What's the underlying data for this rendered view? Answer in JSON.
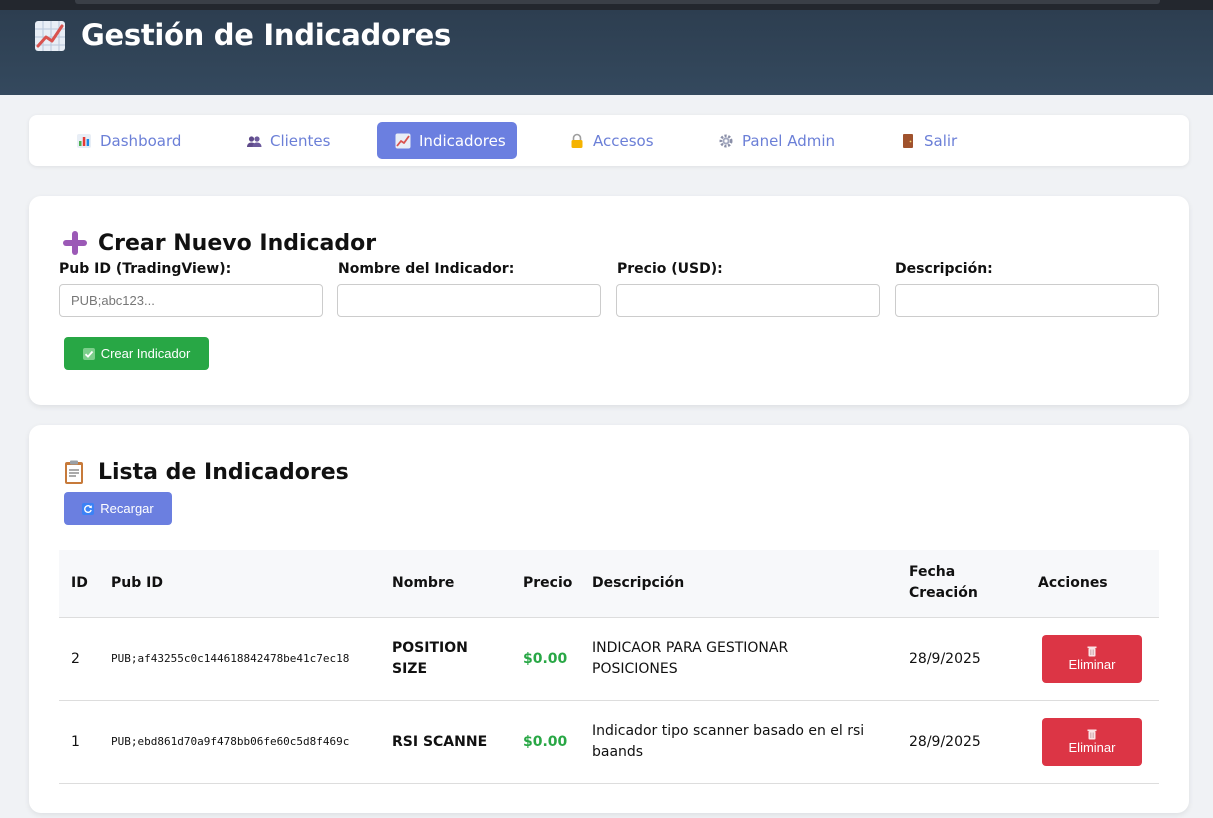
{
  "header": {
    "title": "Gestión de Indicadores",
    "icon": "chart-increasing-icon"
  },
  "nav": {
    "items": [
      {
        "label": "Dashboard",
        "icon": "bar-chart-icon",
        "active": false
      },
      {
        "label": "Clientes",
        "icon": "users-icon",
        "active": false
      },
      {
        "label": "Indicadores",
        "icon": "chart-increasing-icon",
        "active": true
      },
      {
        "label": "Accesos",
        "icon": "lock-icon",
        "active": false
      },
      {
        "label": "Panel Admin",
        "icon": "gear-icon",
        "active": false
      },
      {
        "label": "Salir",
        "icon": "door-icon",
        "active": false
      }
    ]
  },
  "create": {
    "title": "Crear Nuevo Indicador",
    "fields": [
      {
        "label": "Pub ID (TradingView):",
        "placeholder": "PUB;abc123...",
        "value": ""
      },
      {
        "label": "Nombre del Indicador:",
        "placeholder": "",
        "value": ""
      },
      {
        "label": "Precio (USD):",
        "placeholder": "",
        "value": ""
      },
      {
        "label": "Descripción:",
        "placeholder": "",
        "value": ""
      }
    ],
    "submit_label": "Crear Indicador"
  },
  "list": {
    "title": "Lista de Indicadores",
    "reload_label": "Recargar",
    "columns": [
      "ID",
      "Pub ID",
      "Nombre",
      "Precio",
      "Descripción",
      "Fecha Creación",
      "Acciones"
    ],
    "rows": [
      {
        "id": "2",
        "pub_id": "PUB;af43255c0c144618842478be41c7ec18",
        "name": "POSITION SIZE",
        "price": "$0.00",
        "description": "INDICAOR PARA GESTIONAR POSICIONES",
        "date": "28/9/2025",
        "action": "Eliminar"
      },
      {
        "id": "1",
        "pub_id": "PUB;ebd861d70a9f478bb06fe60c5d8f469c",
        "name": "RSI SCANNE",
        "price": "$0.00",
        "description": "Indicador tipo scanner basado en el rsi baands",
        "date": "28/9/2025",
        "action": "Eliminar"
      }
    ]
  },
  "colors": {
    "header": "#2d3e50",
    "accent": "#6b7fe0",
    "success": "#28a745",
    "danger": "#dc3545"
  }
}
